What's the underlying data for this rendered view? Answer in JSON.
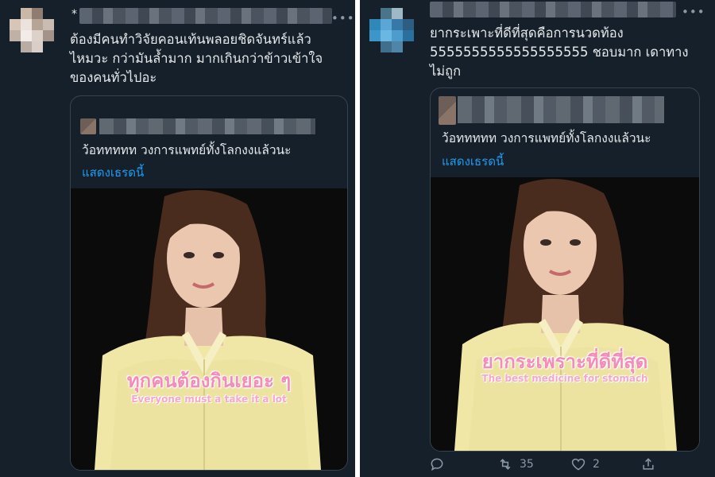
{
  "left_tweet": {
    "star": "*",
    "more_icon": "more-dots-icon",
    "text": "ต้องมีคนทำวิจัยคอนเท้นพลอยชิดจันทร์แล้ว\nไหมวะ กว่ามันล้ำมาก มากเกินกว่าข้าวเข้าใจ\nของคนทั่วไปอะ",
    "quote": {
      "text": "ว้อททททท วงการแพทย์ทั้งโลกงงแล้วนะ",
      "link": "แสดงเธรดนี้",
      "caption_th": "ทุกคนต้องกินเยอะ ๆ",
      "caption_en": "Everyone must a take it a lot"
    }
  },
  "right_tweet": {
    "more_icon": "more-dots-icon",
    "text": "ยากระเพาะที่ดีที่สุดคือการนวดท้อง\n5555555555555555555 ชอบมาก เดาทาง\nไม่ถูก",
    "quote": {
      "text": "ว้อททททท วงการแพทย์ทั้งโลกงงแล้วนะ",
      "link": "แสดงเธรดนี้",
      "caption_th": "ยากระเพราะที่ดีที่สุด",
      "caption_en": "The best medicine for stomach"
    },
    "actions": {
      "reply_icon": "reply-icon",
      "retweet_icon": "retweet-icon",
      "retweet_count": "35",
      "like_icon": "heart-icon",
      "like_count": "2",
      "share_icon": "share-icon"
    }
  },
  "colors": {
    "background": "#15202b",
    "link": "#1d9bf0",
    "caption_pink": "#f48cb8"
  }
}
